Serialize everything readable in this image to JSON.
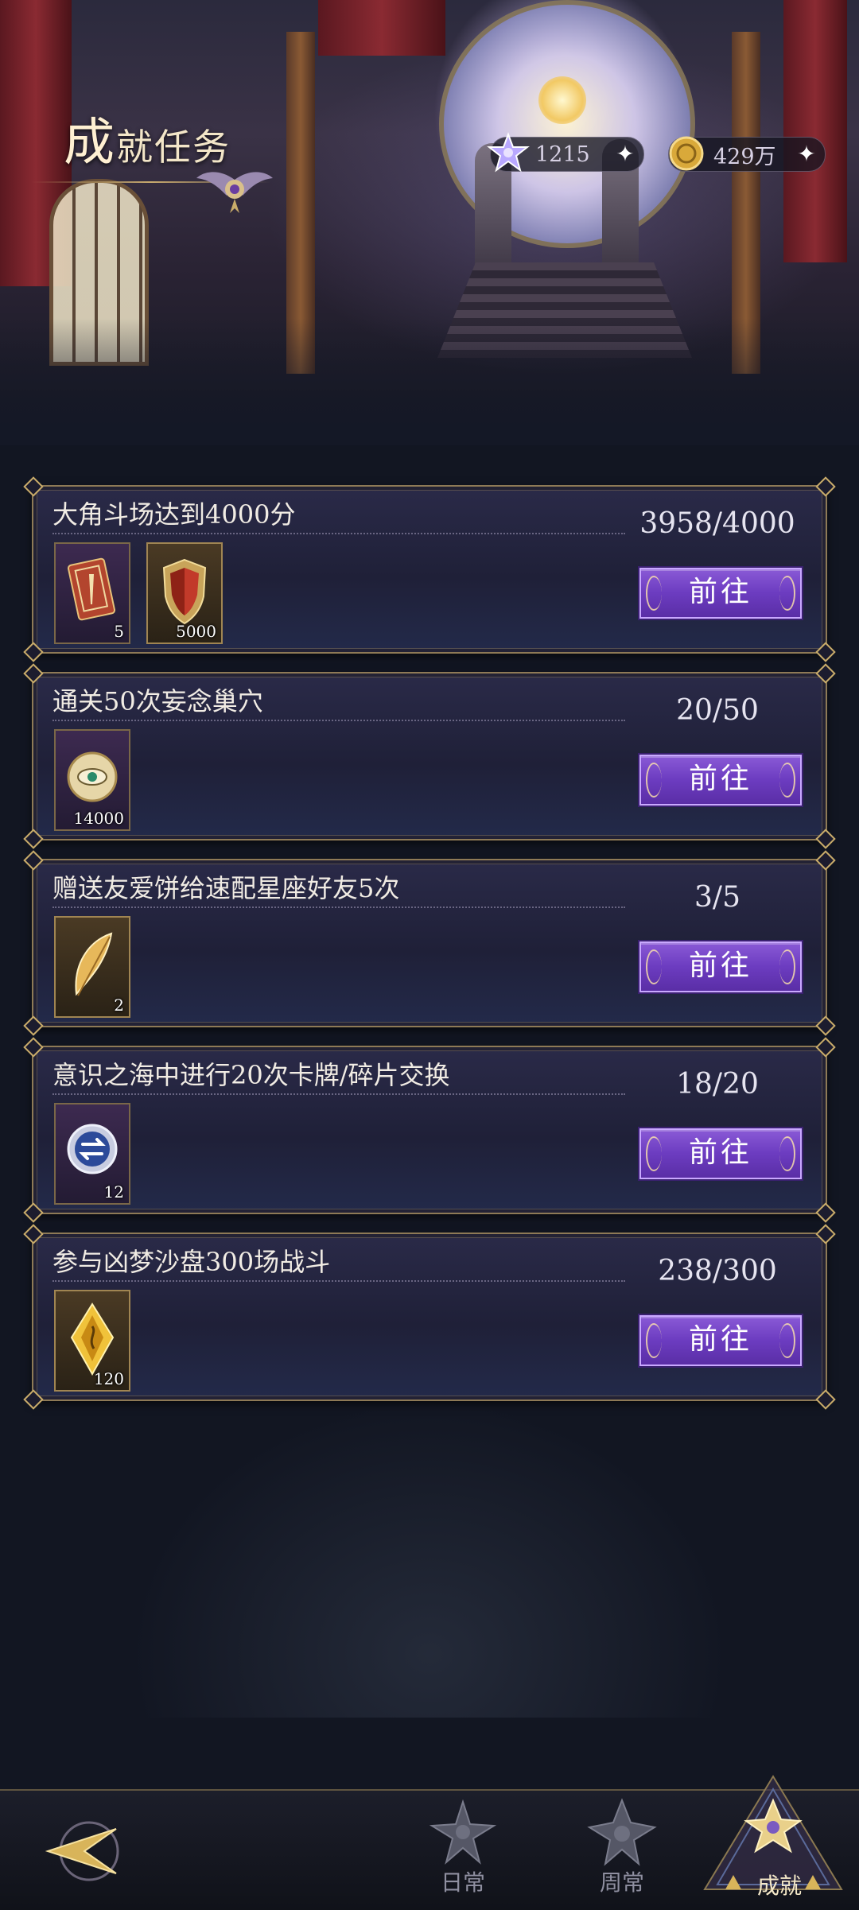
{
  "header": {
    "title_first": "成",
    "title_rest": "就任务",
    "currencies": [
      {
        "name": "star-gem",
        "value": "1215"
      },
      {
        "name": "gold-coin",
        "value": "429万"
      }
    ]
  },
  "tasks": [
    {
      "title": "大角斗场达到4000分",
      "progress": "3958/4000",
      "button": "前往",
      "rewards": [
        {
          "icon": "card-pack-icon",
          "qty": "5"
        },
        {
          "icon": "shield-badge-icon",
          "qty": "5000"
        }
      ]
    },
    {
      "title": "通关50次妄念巢穴",
      "progress": "20/50",
      "button": "前往",
      "rewards": [
        {
          "icon": "eye-coin-icon",
          "qty": "14000"
        }
      ]
    },
    {
      "title": "赠送友爱饼给速配星座好友5次",
      "progress": "3/5",
      "button": "前往",
      "rewards": [
        {
          "icon": "golden-feather-icon",
          "qty": "2"
        }
      ]
    },
    {
      "title": "意识之海中进行20次卡牌/碎片交换",
      "progress": "18/20",
      "button": "前往",
      "rewards": [
        {
          "icon": "exchange-token-icon",
          "qty": "12"
        }
      ]
    },
    {
      "title": "参与凶梦沙盘300场战斗",
      "progress": "238/300",
      "button": "前往",
      "rewards": [
        {
          "icon": "gold-crystal-icon",
          "qty": "120"
        }
      ]
    }
  ],
  "nav": {
    "daily": "日常",
    "weekly": "周常",
    "achievement": "成就"
  },
  "colors": {
    "accent_button": "#6c3cc0",
    "card_border": "#8e7a56",
    "title_text": "#f3e6c8"
  }
}
